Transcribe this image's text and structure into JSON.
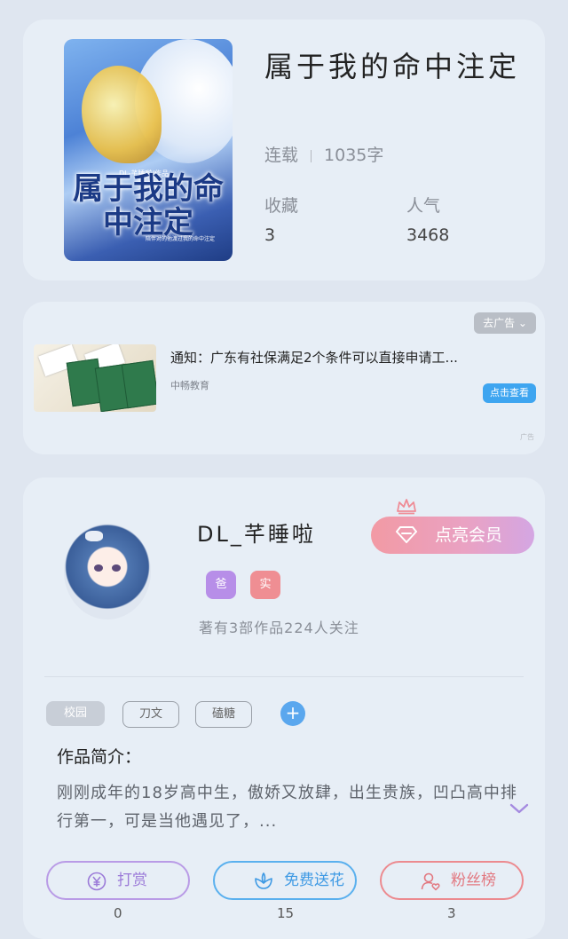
{
  "book": {
    "cover": {
      "title": "属于我的命中注定",
      "author_line": "DL-芊睡啦/作品",
      "subtitle": "陪伴对的他渡过我的命中注定"
    },
    "title": "属于我的命中注定",
    "status": "连载",
    "word_count": "1035字",
    "favorites_label": "收藏",
    "favorites_value": "3",
    "popularity_label": "人气",
    "popularity_value": "3468"
  },
  "ad": {
    "close_label": "去广告 ⌄",
    "title": "通知：广东有社保满足2个条件可以直接申请工...",
    "source": "中畅教育",
    "cta_label": "点击查看",
    "mark": "广告"
  },
  "author": {
    "name": "DL_芊睡啦",
    "vip_label": "点亮会员",
    "badges": [
      "爸",
      "实"
    ],
    "stats": "著有3部作品224人关注",
    "tags": [
      "校园",
      "刀文",
      "磕糖"
    ],
    "add_tag": "+",
    "intro_label": "作品简介：",
    "intro_text": "刚刚成年的18岁高中生，傲娇又放肆，出生贵族，凹凸高中排行第一，可是当他遇见了，..."
  },
  "actions": [
    {
      "label": "打赏",
      "count": "0"
    },
    {
      "label": "免费送花",
      "count": "15"
    },
    {
      "label": "粉丝榜",
      "count": "3"
    }
  ],
  "colors": {
    "page_bg": "#dfe6f0",
    "card_bg": "#e7eef6",
    "reward": "#b99be6",
    "flower": "#5ab0ee",
    "fans": "#ec8a8f",
    "tag_add": "#5aa7ee"
  },
  "icons": {
    "reward": "yen-icon",
    "flower": "flower-icon",
    "fans": "user-heart-icon",
    "vip": "diamond-icon",
    "crown": "crown-icon",
    "expand": "chevron-down-icon"
  }
}
